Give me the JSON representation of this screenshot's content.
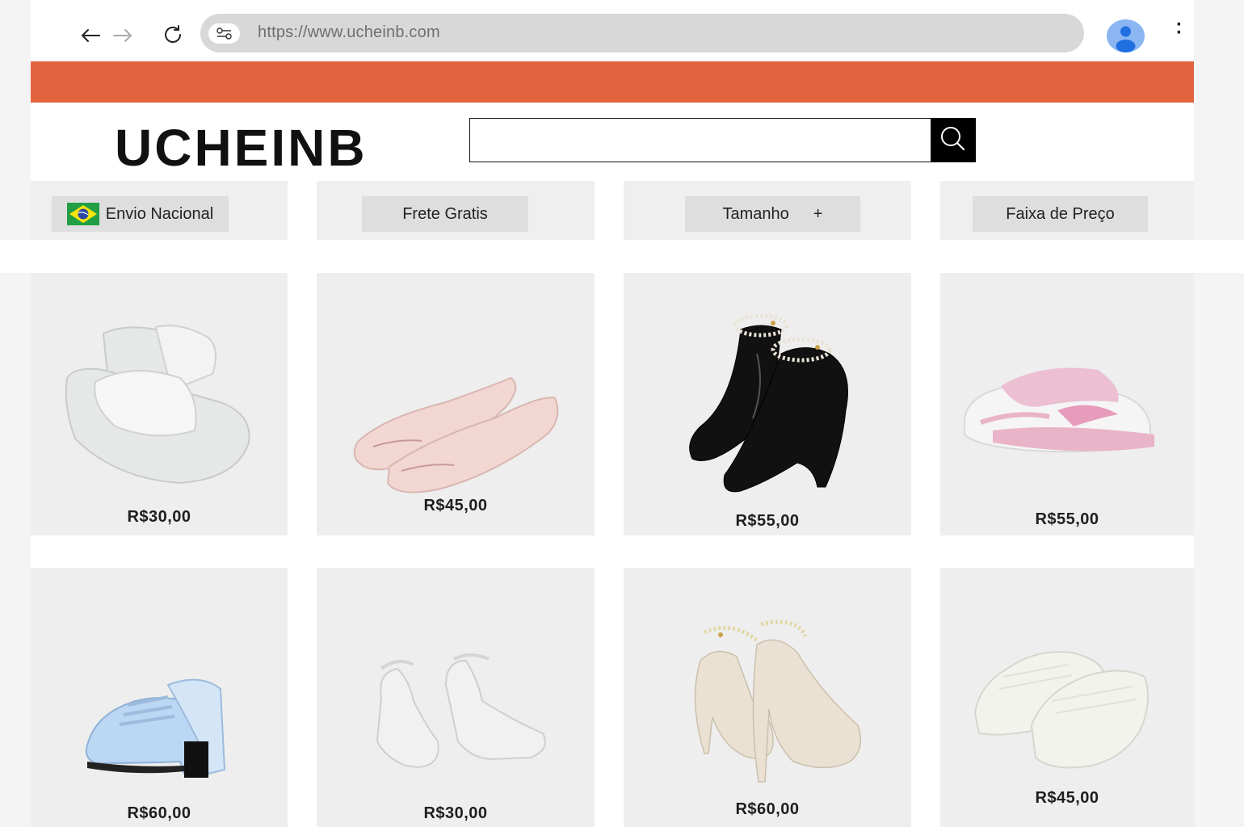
{
  "browser": {
    "url": "https://www.ucheinb.com",
    "icons": {
      "back": "arrow-left-icon",
      "forward": "arrow-right-icon",
      "reload": "reload-icon",
      "site_settings": "tune-icon",
      "profile": "avatar-icon",
      "menu": "more-vertical-icon"
    }
  },
  "theme": {
    "promo_color": "#e0653f",
    "card_bg": "#eeeeee",
    "search_button": "#000000"
  },
  "header": {
    "logo": "UCHEINB",
    "search": {
      "placeholder": "",
      "value": ""
    }
  },
  "filters": {
    "national_shipping": {
      "label": "Envio Nacional",
      "flag": "brazil-flag-icon"
    },
    "free_shipping": {
      "label": "Frete Gratis"
    },
    "size": {
      "label": "Tamanho",
      "suffix": "+"
    },
    "price_range": {
      "label": "Faixa de Preço"
    }
  },
  "products": [
    {
      "image": "white-platform-slide-sandals",
      "price": "R$30,00"
    },
    {
      "image": "pink-ballet-flats",
      "price": "R$45,00"
    },
    {
      "image": "black-patent-pumps-pearl-strap",
      "price": "R$55,00"
    },
    {
      "image": "pink-white-sneakers",
      "price": "R$55,00"
    },
    {
      "image": "light-blue-platform-mary-janes",
      "price": "R$60,00"
    },
    {
      "image": "white-platform-ankle-strap-shoes",
      "price": "R$30,00"
    },
    {
      "image": "beige-patent-pumps-pearl-strap",
      "price": "R$60,00"
    },
    {
      "image": "cream-slide-sandals",
      "price": "R$45,00"
    }
  ]
}
